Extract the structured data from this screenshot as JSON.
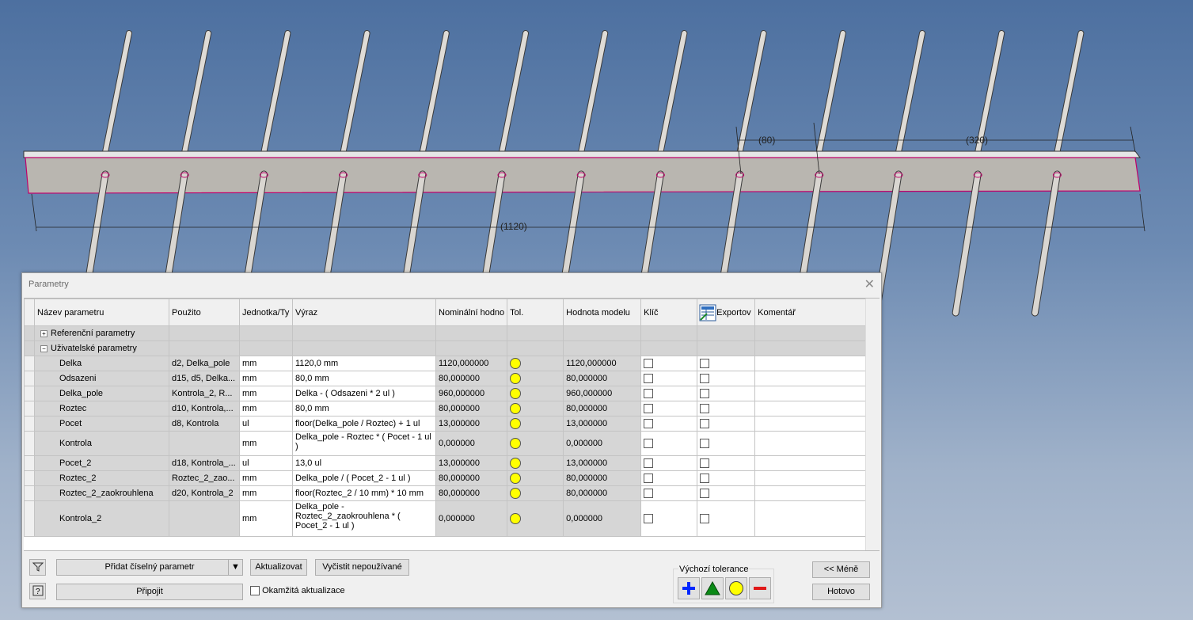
{
  "dimensions": {
    "d1120": "(1120)",
    "d80": "(80)",
    "d320": "(320)"
  },
  "dialog": {
    "title": "Parametry",
    "close": "✕",
    "columns": [
      "Název parametru",
      "Použito",
      "Jednotka/Ty",
      "Výraz",
      "Nominální hodno",
      "Tol.",
      "Hodnota modelu",
      "Klíč",
      "Exportov",
      "Komentář"
    ],
    "sections": {
      "reference": "Referenční parametry",
      "user": "Uživatelské parametry"
    },
    "rows": [
      {
        "name": "Delka",
        "used": "d2, Delka_pole",
        "unit": "mm",
        "expr": "1120,0 mm",
        "nominal": "1120,000000",
        "model": "1120,000000"
      },
      {
        "name": "Odsazeni",
        "used": "d15, d5, Delka...",
        "unit": "mm",
        "expr": "80,0 mm",
        "nominal": "80,000000",
        "model": "80,000000"
      },
      {
        "name": "Delka_pole",
        "used": "Kontrola_2, R...",
        "unit": "mm",
        "expr": "Delka - ( Odsazeni * 2 ul )",
        "nominal": "960,000000",
        "model": "960,000000"
      },
      {
        "name": "Roztec",
        "used": "d10, Kontrola,...",
        "unit": "mm",
        "expr": "80,0 mm",
        "nominal": "80,000000",
        "model": "80,000000"
      },
      {
        "name": "Pocet",
        "used": "d8, Kontrola",
        "unit": "ul",
        "expr": "floor(Delka_pole / Roztec) + 1 ul",
        "nominal": "13,000000",
        "model": "13,000000"
      },
      {
        "name": "Kontrola",
        "used": "",
        "unit": "mm",
        "expr": "Delka_pole - Roztec * ( Pocet - 1 ul )",
        "nominal": "0,000000",
        "model": "0,000000"
      },
      {
        "name": "Pocet_2",
        "used": "d18, Kontrola_...",
        "unit": "ul",
        "expr": "13,0 ul",
        "nominal": "13,000000",
        "model": "13,000000"
      },
      {
        "name": "Roztec_2",
        "used": "Roztec_2_zao...",
        "unit": "mm",
        "expr": "Delka_pole / ( Pocet_2 - 1 ul )",
        "nominal": "80,000000",
        "model": "80,000000"
      },
      {
        "name": "Roztec_2_zaokrouhlena",
        "used": "d20, Kontrola_2",
        "unit": "mm",
        "expr": "floor(Roztec_2 / 10 mm) * 10 mm",
        "nominal": "80,000000",
        "model": "80,000000"
      },
      {
        "name": "Kontrola_2",
        "used": "",
        "unit": "mm",
        "expr": "Delka_pole - Roztec_2_zaokrouhlena * ( Pocet_2 - 1 ul )",
        "nominal": "0,000000",
        "model": "0,000000"
      }
    ],
    "footer": {
      "add_param": "Přidat číselný parametr",
      "update": "Aktualizovat",
      "purge": "Vyčistit nepoužívané",
      "link": "Připojit",
      "immediate": "Okamžitá aktualizace",
      "tolerance_label": "Výchozí tolerance",
      "less": "<< Méně",
      "done": "Hotovo"
    },
    "colors": {
      "tol_yellow": "#ffff00",
      "plus_blue": "#0026ff",
      "triangle_green": "#0a8a16",
      "minus_red": "#e01818"
    }
  }
}
